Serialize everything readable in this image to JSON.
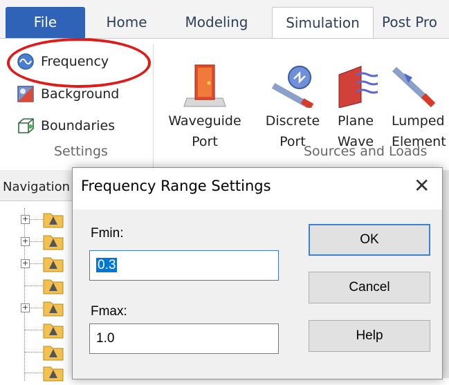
{
  "ribbon_tabs": {
    "file": "File",
    "home": "Home",
    "modeling": "Modeling",
    "simulation": "Simulation",
    "post": "Post Pro"
  },
  "settings_group": {
    "frequency": "Frequency",
    "background": "Background",
    "boundaries": "Boundaries",
    "label": "Settings"
  },
  "sources_group": {
    "waveguide_port": [
      "Waveguide",
      "Port"
    ],
    "discrete_port": [
      "Discrete",
      "Port"
    ],
    "plane_wave": [
      "Plane",
      "Wave"
    ],
    "lumped_element": [
      "Lumped",
      "Element"
    ],
    "label": "Sources and Loads"
  },
  "navigation": {
    "title": "Navigation"
  },
  "dialog": {
    "title": "Frequency Range Settings",
    "close_icon": "close-icon",
    "fmin_label": "Fmin:",
    "fmin_value": "0.3",
    "fmax_label": "Fmax:",
    "fmax_value": "1.0",
    "ok": "OK",
    "cancel": "Cancel",
    "help": "Help"
  },
  "colors": {
    "file_tab": "#2f63b7",
    "highlight_circle": "#e01919",
    "selection": "#0078d7"
  }
}
